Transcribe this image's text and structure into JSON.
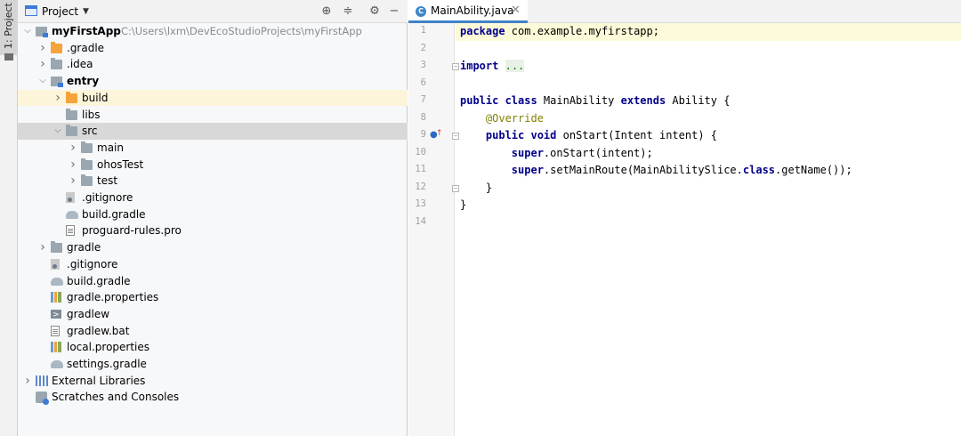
{
  "side_tab": {
    "label": "1: Project"
  },
  "project_panel": {
    "header": {
      "title": "Project"
    },
    "tree": [
      {
        "label": "myFirstApp",
        "path": "C:\\Users\\lxm\\DevEcoStudioProjects\\myFirstApp",
        "type": "module",
        "depth": 0,
        "arrow": "down",
        "bold": true
      },
      {
        "label": ".gradle",
        "type": "folder-orange",
        "depth": 1,
        "arrow": "right"
      },
      {
        "label": ".idea",
        "type": "folder-gray",
        "depth": 1,
        "arrow": "right"
      },
      {
        "label": "entry",
        "type": "module",
        "depth": 1,
        "arrow": "down",
        "bold": true
      },
      {
        "label": "build",
        "type": "folder-orange",
        "depth": 2,
        "arrow": "right",
        "highlight": "yellow"
      },
      {
        "label": "libs",
        "type": "folder-gray",
        "depth": 2,
        "arrow": ""
      },
      {
        "label": "src",
        "type": "folder-gray",
        "depth": 2,
        "arrow": "down",
        "highlight": "gray"
      },
      {
        "label": "main",
        "type": "folder-gray",
        "depth": 3,
        "arrow": "right"
      },
      {
        "label": "ohosTest",
        "type": "folder-gray",
        "depth": 3,
        "arrow": "right"
      },
      {
        "label": "test",
        "type": "folder-gray",
        "depth": 3,
        "arrow": "right"
      },
      {
        "label": ".gitignore",
        "type": "file-git",
        "depth": 2,
        "arrow": ""
      },
      {
        "label": "build.gradle",
        "type": "file-gradle",
        "depth": 2,
        "arrow": ""
      },
      {
        "label": "proguard-rules.pro",
        "type": "file-doc",
        "depth": 2,
        "arrow": ""
      },
      {
        "label": "gradle",
        "type": "folder-gray",
        "depth": 1,
        "arrow": "right"
      },
      {
        "label": ".gitignore",
        "type": "file-git",
        "depth": 1,
        "arrow": ""
      },
      {
        "label": "build.gradle",
        "type": "file-gradle",
        "depth": 1,
        "arrow": ""
      },
      {
        "label": "gradle.properties",
        "type": "file-props",
        "depth": 1,
        "arrow": ""
      },
      {
        "label": "gradlew",
        "type": "file-term",
        "depth": 1,
        "arrow": ""
      },
      {
        "label": "gradlew.bat",
        "type": "file-doc",
        "depth": 1,
        "arrow": ""
      },
      {
        "label": "local.properties",
        "type": "file-props",
        "depth": 1,
        "arrow": ""
      },
      {
        "label": "settings.gradle",
        "type": "file-gradle",
        "depth": 1,
        "arrow": ""
      },
      {
        "label": "External Libraries",
        "type": "libs-icon",
        "depth": 0,
        "arrow": "right"
      },
      {
        "label": "Scratches and Consoles",
        "type": "scratch-icon",
        "depth": 0,
        "arrow": ""
      }
    ]
  },
  "editor": {
    "tab": {
      "label": "MainAbility.java",
      "icon": "C"
    },
    "lines": [
      {
        "n": "1",
        "current": true,
        "tokens": [
          [
            "kw",
            "package"
          ],
          [
            "",
            " com.example.myfirstapp;"
          ]
        ]
      },
      {
        "n": "2",
        "tokens": []
      },
      {
        "n": "3",
        "tokens": [
          [
            "kw",
            "import"
          ],
          [
            "",
            " "
          ],
          [
            "fold-dots",
            "..."
          ]
        ]
      },
      {
        "n": "6",
        "tokens": []
      },
      {
        "n": "7",
        "tokens": [
          [
            "kw",
            "public class"
          ],
          [
            "",
            " MainAbility "
          ],
          [
            "kw",
            "extends"
          ],
          [
            "",
            " Ability {"
          ]
        ]
      },
      {
        "n": "8",
        "tokens": [
          [
            "",
            "    "
          ],
          [
            "ann",
            "@Override"
          ]
        ]
      },
      {
        "n": "9",
        "tokens": [
          [
            "",
            "    "
          ],
          [
            "kw",
            "public void"
          ],
          [
            "",
            " onStart(Intent intent) {"
          ]
        ]
      },
      {
        "n": "10",
        "tokens": [
          [
            "",
            "        "
          ],
          [
            "kw",
            "super"
          ],
          [
            "",
            ".onStart(intent);"
          ]
        ]
      },
      {
        "n": "11",
        "tokens": [
          [
            "",
            "        "
          ],
          [
            "kw",
            "super"
          ],
          [
            "",
            ".setMainRoute(MainAbilitySlice."
          ],
          [
            "kw",
            "class"
          ],
          [
            "",
            ".getName());"
          ]
        ]
      },
      {
        "n": "12",
        "tokens": [
          [
            "",
            "    }"
          ]
        ]
      },
      {
        "n": "13",
        "tokens": [
          [
            "",
            "}"
          ]
        ]
      },
      {
        "n": "14",
        "tokens": []
      }
    ]
  }
}
